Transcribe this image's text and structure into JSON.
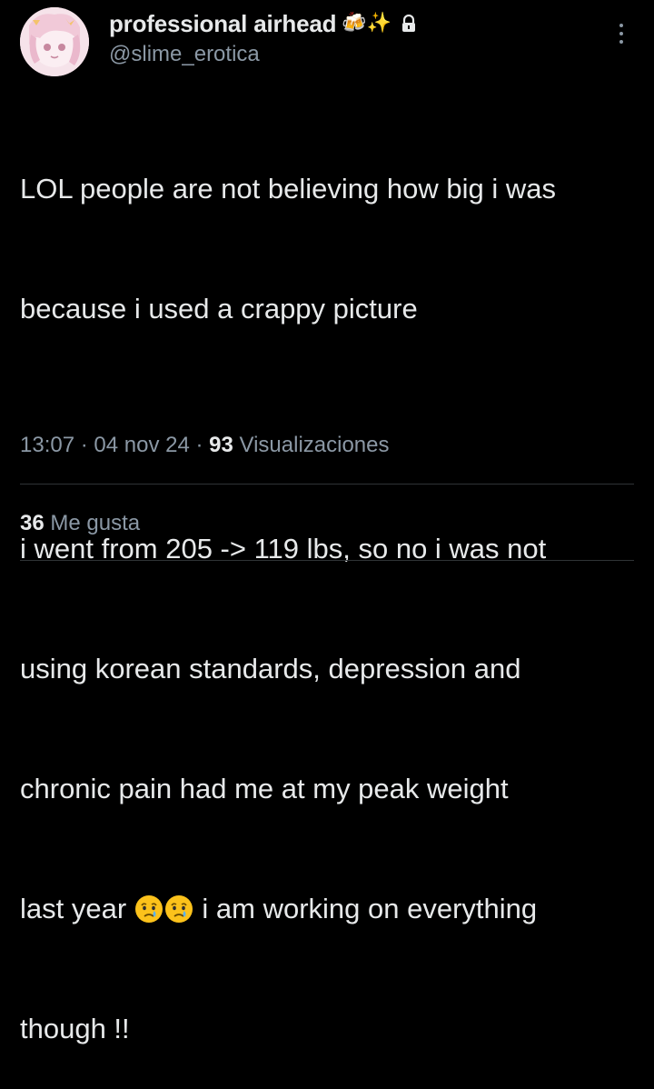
{
  "author": {
    "display_name": "professional airhead",
    "name_emoji": "🍻✨",
    "handle": "@slime_erotica"
  },
  "icons": {
    "lock": "lock-icon",
    "more": "more-options-icon",
    "emoji_inline": "crying-face-icon"
  },
  "tweet": {
    "line1": "LOL people are not believing how big i was",
    "line2": "because i used a crappy picture",
    "line3": "",
    "line4": "i went from 205 -> 119 lbs, so no i was not",
    "line5": "using korean standards, depression and",
    "line6": "chronic pain had me at my peak weight",
    "line7_before": "last year ",
    "line7_after": " i am working on everything",
    "line8": "though !!"
  },
  "meta": {
    "time": "13:07",
    "sep1": " · ",
    "date": "04 nov 24",
    "sep2": " · ",
    "views_count": "93",
    "views_label": " Visualizaciones"
  },
  "engagement": {
    "likes_count": "36",
    "likes_label": " Me gusta"
  },
  "colors": {
    "background": "#000000",
    "primary_text": "#e7e9ea",
    "secondary_text": "#8b98a5",
    "divider": "#2f3336"
  }
}
